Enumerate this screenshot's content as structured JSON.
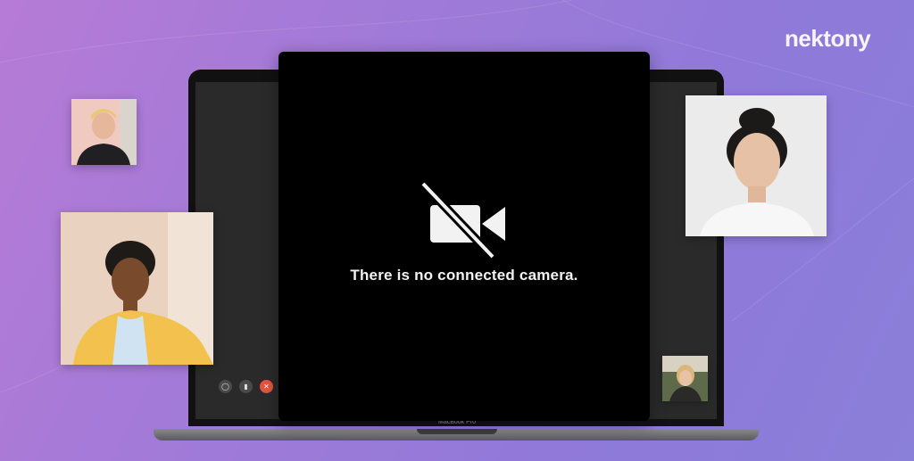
{
  "brand": {
    "logo_text": "nektony"
  },
  "laptop": {
    "model_label": "MacBook Pro"
  },
  "camera_window": {
    "message": "There is no connected camera.",
    "icon": "video-camera-off-icon"
  },
  "call_controls": [
    {
      "icon": "video-icon"
    },
    {
      "icon": "microphone-icon"
    },
    {
      "icon": "end-call-icon"
    }
  ],
  "participants": [
    {
      "slot": "top-left-small"
    },
    {
      "slot": "left-large"
    },
    {
      "slot": "right-large"
    },
    {
      "slot": "bottom-right-small"
    }
  ],
  "colors": {
    "background_start": "#b67bd6",
    "background_end": "#8a7fd9",
    "end_call": "#e0563f",
    "window": "#000000"
  }
}
